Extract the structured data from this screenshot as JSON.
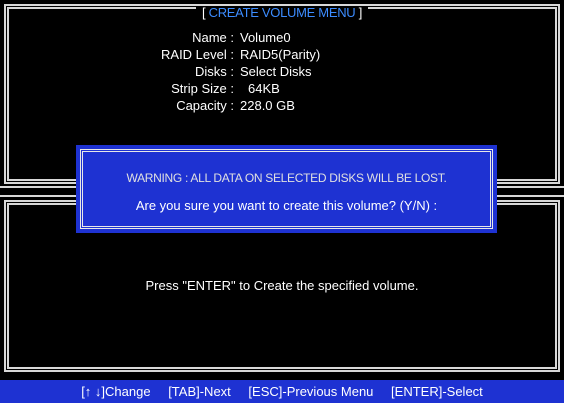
{
  "menu": {
    "title": "CREATE VOLUME MENU",
    "bracket_open": "[",
    "bracket_close": "]"
  },
  "fields": [
    {
      "label": "Name :",
      "value": "Volume0"
    },
    {
      "label": "RAID Level :",
      "value": "RAID5(Parity)"
    },
    {
      "label": "Disks :",
      "value": "Select Disks"
    },
    {
      "label": "Strip Size :",
      "value": "64KB"
    },
    {
      "label": "Capacity :",
      "value": "228.0  GB"
    }
  ],
  "dialog": {
    "warning": "WARNING : ALL DATA ON SELECTED DISKS WILL BE LOST.",
    "confirm": "Are you sure you want to create this volume?  (Y/N) :"
  },
  "help_text": "Press \"ENTER\" to Create the specified volume.",
  "footer": {
    "change": "[↑ ↓]Change",
    "next": "[TAB]-Next",
    "previous": "[ESC]-Previous Menu",
    "select": "[ENTER]-Select"
  }
}
